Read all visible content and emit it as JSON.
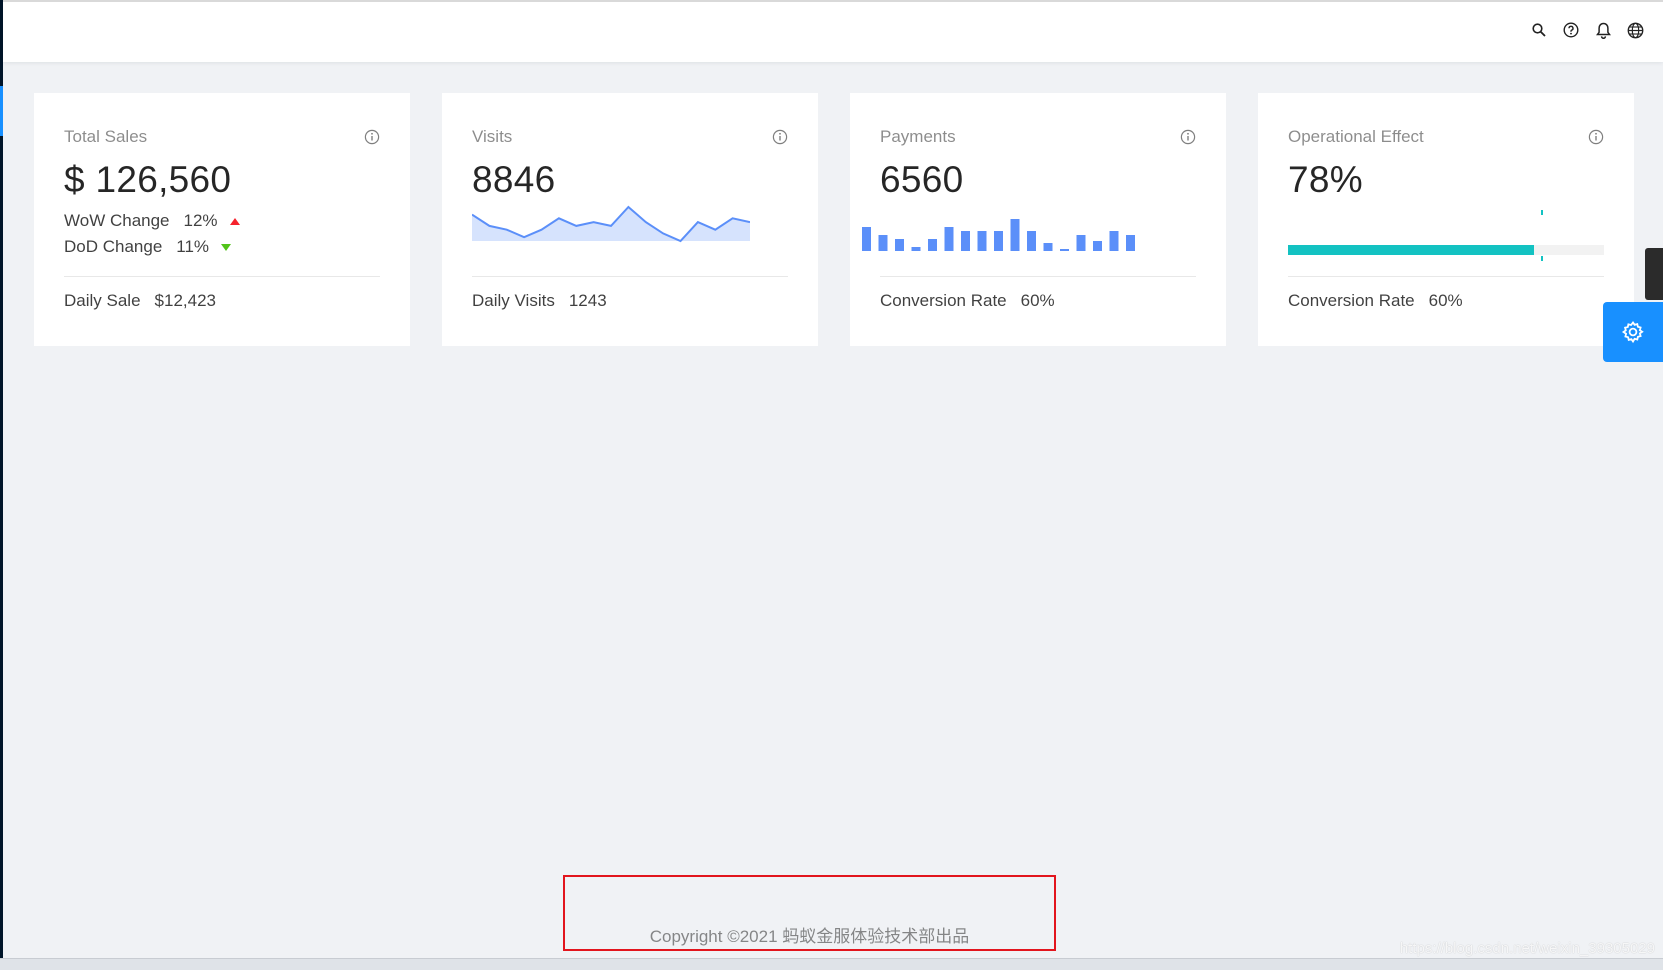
{
  "header": {
    "icons": [
      "search-icon",
      "question-icon",
      "bell-icon",
      "globe-icon"
    ]
  },
  "cards": {
    "total_sales": {
      "title": "Total Sales",
      "value": "$ 126,560",
      "wow_label": "WoW Change",
      "wow_value": "12%",
      "dod_label": "DoD Change",
      "dod_value": "11%",
      "footer_label": "Daily Sale",
      "footer_value": "$12,423"
    },
    "visits": {
      "title": "Visits",
      "value": "8846",
      "footer_label": "Daily Visits",
      "footer_value": "1243"
    },
    "payments": {
      "title": "Payments",
      "value": "6560",
      "footer_label": "Conversion Rate",
      "footer_value": "60%"
    },
    "operational_effect": {
      "title": "Operational Effect",
      "value": "78%",
      "progress_percent": 78,
      "target_percent": 80,
      "footer_label": "Conversion Rate",
      "footer_value": "60%"
    }
  },
  "chart_data": [
    {
      "type": "area",
      "values": [
        7,
        4,
        3,
        1,
        3,
        6,
        4,
        5,
        4,
        9,
        5,
        2,
        0,
        5,
        3,
        6,
        5
      ]
    },
    {
      "type": "bar",
      "values": [
        6,
        4,
        3,
        1,
        3,
        6,
        5,
        5,
        5,
        8,
        5,
        2,
        0.5,
        4,
        2.5,
        5,
        4
      ]
    }
  ],
  "footer": {
    "copyright": "Copyright ©2021 蚂蚁金服体验技术部出品"
  },
  "watermark": "https://blog.csdn.net/weixin_39305029",
  "colors": {
    "primary": "#1890ff",
    "sparkline": "#5b8ff9",
    "progress": "#13c2c2",
    "up": "#f5222d",
    "down": "#52c41a",
    "highlight_box": "#e2151d"
  }
}
